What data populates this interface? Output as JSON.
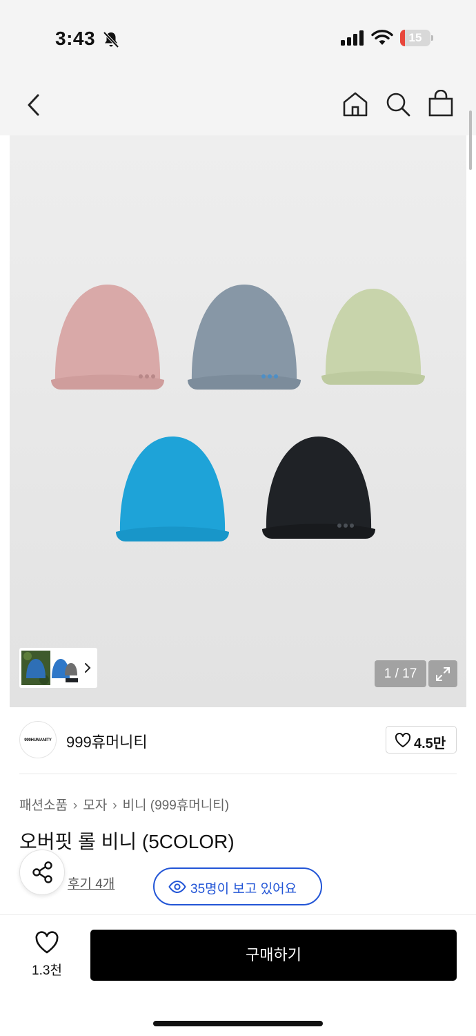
{
  "status_bar": {
    "time": "3:43",
    "battery": "15",
    "battery_level_percent": 15
  },
  "nav": {
    "icons": [
      "back-icon",
      "home-icon",
      "search-icon",
      "shopping-bag-icon"
    ]
  },
  "gallery": {
    "counter": "1 / 17",
    "beanie_colors": [
      "#d9a9a8",
      "#8797a6",
      "#c8d4ab",
      "#1ea3d8",
      "#1f2226"
    ]
  },
  "brand": {
    "logo_text": "999HUMANITY",
    "name": "999휴머니티",
    "likes": "4.5만"
  },
  "breadcrumb": {
    "level1": "패션소품",
    "level2": "모자",
    "level3": "비니 (999휴머니티)"
  },
  "product": {
    "title": "오버핏 롤 비니 (5COLOR)"
  },
  "review": {
    "link": "후기 4개"
  },
  "viewers": {
    "text": "35명이 보고 있어요"
  },
  "bottom": {
    "wish_count": "1.3천",
    "buy_label": "구매하기"
  },
  "colors": {
    "accent_blue": "#2255d6",
    "buy_bg": "#000000"
  }
}
